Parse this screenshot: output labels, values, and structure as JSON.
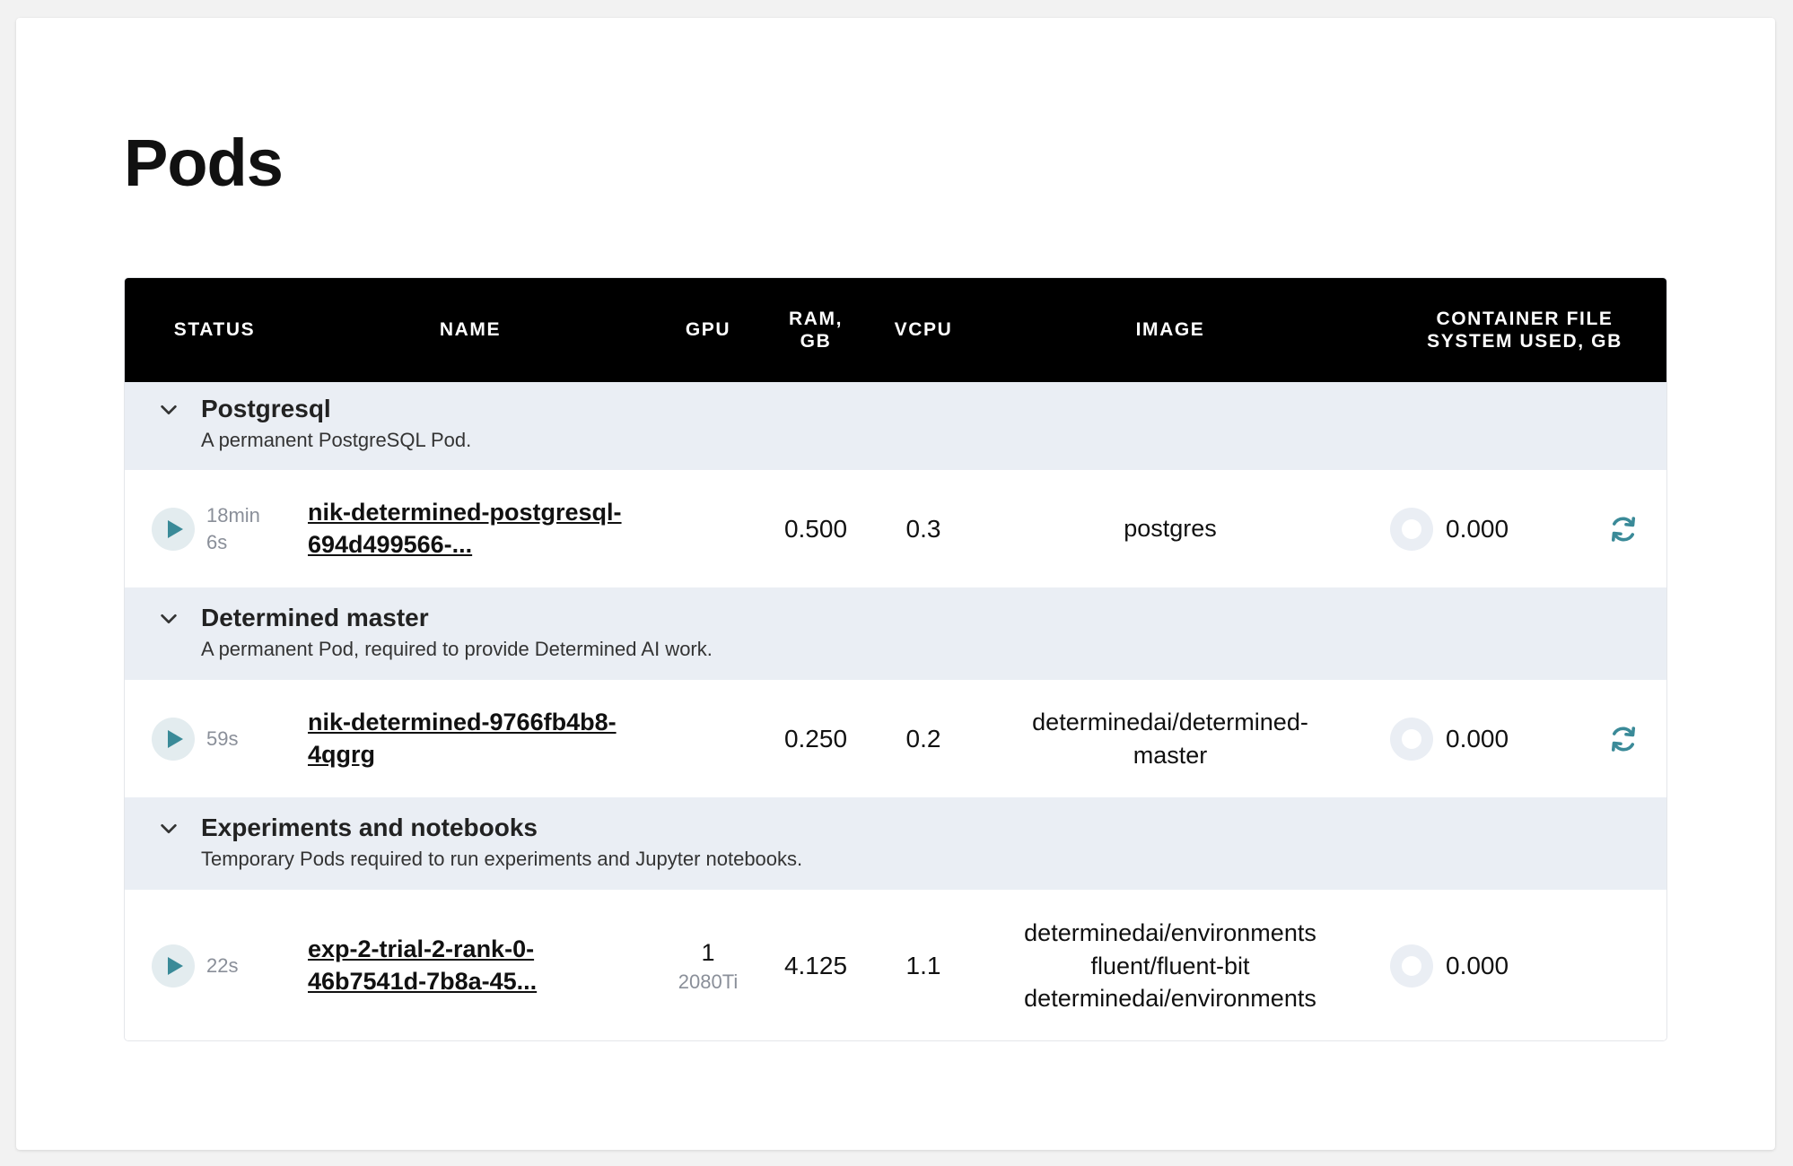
{
  "page": {
    "title": "Pods"
  },
  "table": {
    "columns": {
      "status": "STATUS",
      "name": "NAME",
      "gpu": "GPU",
      "ram_line1": "RAM,",
      "ram_line2": "GB",
      "vcpu": "VCPU",
      "image": "IMAGE",
      "fs_line1": "CONTAINER FILE",
      "fs_line2": "SYSTEM USED, GB"
    },
    "groups": [
      {
        "title": "Postgresql",
        "description": "A permanent PostgreSQL Pod.",
        "row": {
          "age_line1": "18min",
          "age_line2": "6s",
          "name_line1": "nik-determined-postgresql-",
          "name_line2": "694d499566-...",
          "gpu_count": "",
          "gpu_type": "",
          "ram": "0.500",
          "vcpu": "0.3",
          "image_lines": [
            "postgres"
          ],
          "fs_used": "0.000"
        }
      },
      {
        "title": "Determined master",
        "description": "A permanent Pod, required to provide Determined AI work.",
        "row": {
          "age_line1": "59s",
          "age_line2": "",
          "name_line1": "nik-determined-9766fb4b8-",
          "name_line2": "4qgrg",
          "gpu_count": "",
          "gpu_type": "",
          "ram": "0.250",
          "vcpu": "0.2",
          "image_lines": [
            "determinedai/determined-",
            "master"
          ],
          "fs_used": "0.000"
        }
      },
      {
        "title": "Experiments and notebooks",
        "description": "Temporary Pods required to run experiments and Jupyter notebooks.",
        "row": {
          "age_line1": "22s",
          "age_line2": "",
          "name_line1": "exp-2-trial-2-rank-0-",
          "name_line2": "46b7541d-7b8a-45...",
          "gpu_count": "1",
          "gpu_type": "2080Ti",
          "ram": "4.125",
          "vcpu": "1.1",
          "image_lines": [
            "determinedai/environments",
            "fluent/fluent-bit",
            "determinedai/environments"
          ],
          "fs_used": "0.000"
        }
      }
    ]
  },
  "colors": {
    "header_bg": "#000000",
    "group_bg": "#eaeef4",
    "accent": "#3a8a98",
    "muted": "#8a8f99"
  },
  "icons": {
    "expand": "chevron-down-icon",
    "status": "play-icon",
    "restart": "refresh-icon"
  }
}
